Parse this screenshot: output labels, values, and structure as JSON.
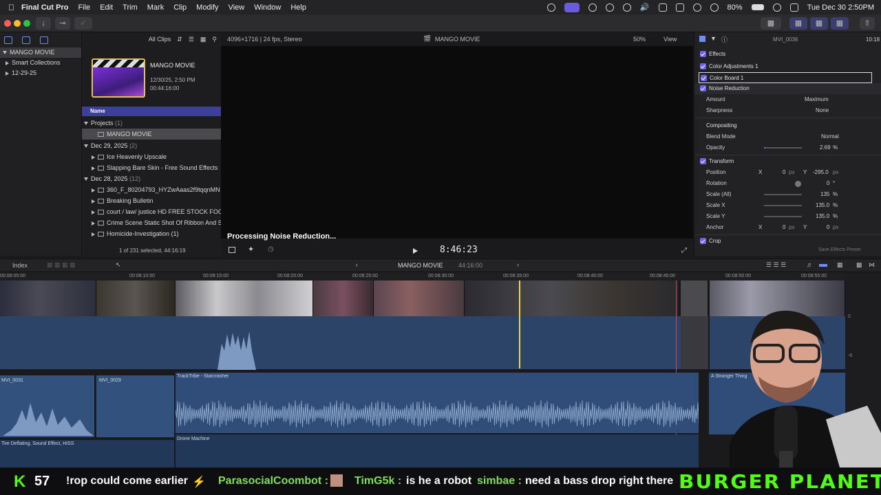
{
  "menubar": {
    "app": "Final Cut Pro",
    "items": [
      "File",
      "Edit",
      "Trim",
      "Mark",
      "Clip",
      "Modify",
      "View",
      "Window",
      "Help"
    ],
    "battery": "80%",
    "datetime": "Tue Dec 30  2:50PM"
  },
  "sidebar": {
    "libraries": [
      {
        "label": "MANGO MOVIE"
      },
      {
        "label": "Smart Collections"
      },
      {
        "label": "12-29-25"
      }
    ]
  },
  "browser": {
    "filter": "All Clips",
    "project_thumb": {
      "title": "MANGO MOVIE",
      "date": "12/30/25, 2:50 PM",
      "duration": "00:44:16:00"
    },
    "column_name": "Name",
    "groups": [
      {
        "label": "Projects",
        "count": "(1)",
        "items": [
          "MANGO MOVIE"
        ]
      },
      {
        "label": "Dec 29, 2025",
        "count": "(2)",
        "items": [
          "Ice Heavenly Upscale",
          "Slapping Bare Skin - Free Sound Effects"
        ]
      },
      {
        "label": "Dec 28, 2025",
        "count": "(12)",
        "items": [
          "360_F_80204793_HYZwAaas2f9tqqnMN",
          "Breaking Bulletin",
          "court / law/ justice HD FREE STOCK FOO",
          "Crime Scene Static Shot Of Ribbon And S",
          "Homicide-Investigation (1)"
        ]
      }
    ],
    "status": "1 of 231 selected, 44:16:19"
  },
  "viewer": {
    "format": "4096×1716 | 24 fps, Stereo",
    "title": "MANGO MOVIE",
    "zoom": "50%",
    "view_menu": "View",
    "processing": "Processing Noise Reduction...",
    "timecode": "8:46:23"
  },
  "inspector": {
    "clip": "MVI_0036",
    "duration": "10:18",
    "effects_header": "Effects",
    "effects": [
      "Color Adjustments 1",
      "Color Board 1",
      "Noise Reduction"
    ],
    "amount_label": "Amount",
    "amount_value": "Maximum",
    "sharpness_label": "Sharpness",
    "sharpness_value": "None",
    "compositing": "Compositing",
    "blend_label": "Blend Mode",
    "blend_value": "Normal",
    "opacity_label": "Opacity",
    "opacity_value": "2.69",
    "opacity_unit": "%",
    "opacity_level": 0.027,
    "transform": "Transform",
    "position_label": "Position",
    "pos_x": "0",
    "pos_y": "-295.0",
    "rotation_label": "Rotation",
    "rotation_value": "0",
    "scale_all_label": "Scale (All)",
    "scale_all_value": "135",
    "scale_x_label": "Scale X",
    "scale_x_value": "135.0",
    "scale_y_label": "Scale Y",
    "scale_y_value": "135.0",
    "anchor_label": "Anchor",
    "anchor_x": "0",
    "anchor_y": "0",
    "crop": "Crop",
    "save_preset": "Save Effects Preset",
    "px": "px",
    "x": "X",
    "y": "Y",
    "pct": "%",
    "deg": "°"
  },
  "timeline": {
    "index": "Index",
    "project": "MANGO MOVIE",
    "duration": "44:16:00",
    "ruler": [
      "00:08:05:00",
      "00:08:10:00",
      "00:08:15:00",
      "00:08:20:00",
      "00:08:25:00",
      "00:08:30:00",
      "00:08:35:00",
      "00:08:40:00",
      "00:08:45:00",
      "00:08:50:00",
      "00:08:55:00"
    ],
    "clips": {
      "a1": "MVI_0031",
      "a2": "MVI_0029",
      "music": "TrackTribe - Starcrasher",
      "drone": "Drone Machine",
      "sfx": "Tire Deflating, Sound Effect, HISS",
      "stranger": "A Stranger Thing"
    },
    "meter_marks": [
      "0",
      "-6"
    ]
  },
  "ticker": {
    "logo": "K",
    "viewers": "57",
    "m1": "!rop could come earlier",
    "user2": "ParasocialCoombot :",
    "user3": "TimG5k :",
    "m3": "is he a robot",
    "user4": "simbae :",
    "m4": "need a bass drop right there",
    "banner": "BURGER PLANET"
  }
}
